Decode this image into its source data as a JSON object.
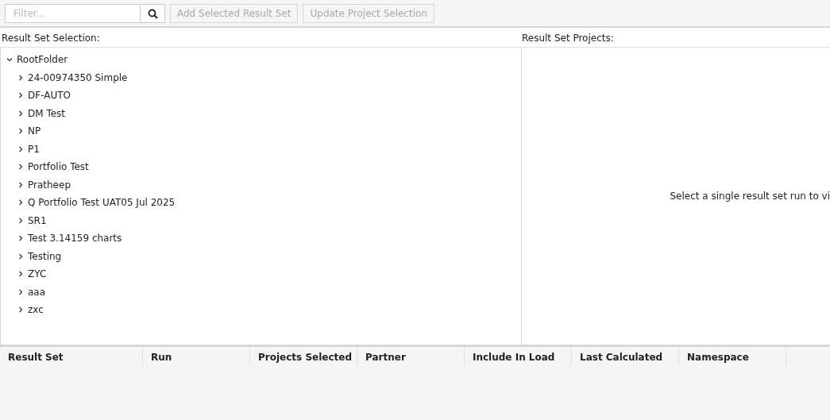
{
  "toolbar": {
    "filter": {
      "placeholder": "Filter..."
    },
    "buttons": [
      {
        "label": "Add Selected Result Set",
        "disabled": true
      },
      {
        "label": "Update Project Selection",
        "disabled": true
      }
    ]
  },
  "result_set_selection": {
    "label": "Result Set Selection:",
    "tree": [
      {
        "label": "RootFolder",
        "expanded": true,
        "children": [
          {
            "label": "24-00974350 Simple",
            "expanded": false
          },
          {
            "label": "DF-AUTO",
            "expanded": false
          },
          {
            "label": "DM Test",
            "expanded": false
          },
          {
            "label": "NP",
            "expanded": false
          },
          {
            "label": "P1",
            "expanded": false
          },
          {
            "label": "Portfolio Test",
            "expanded": false
          },
          {
            "label": "Pratheep",
            "expanded": false
          },
          {
            "label": "Q Portfolio Test UAT05 Jul 2025",
            "expanded": false
          },
          {
            "label": "SR1",
            "expanded": false
          },
          {
            "label": "Test 3.14159 charts",
            "expanded": false
          },
          {
            "label": "Testing",
            "expanded": false
          },
          {
            "label": "ZYC",
            "expanded": false
          },
          {
            "label": "aaa",
            "expanded": false
          },
          {
            "label": "zxc",
            "expanded": false
          }
        ]
      }
    ]
  },
  "result_set_projects": {
    "label": "Result Set Projects:",
    "message": "Select a single result set run to vi"
  },
  "table": {
    "columns": [
      "Result Set",
      "Run",
      "Projects Selected",
      "Partner",
      "Include In Load",
      "Last Calculated",
      "Namespace"
    ]
  }
}
